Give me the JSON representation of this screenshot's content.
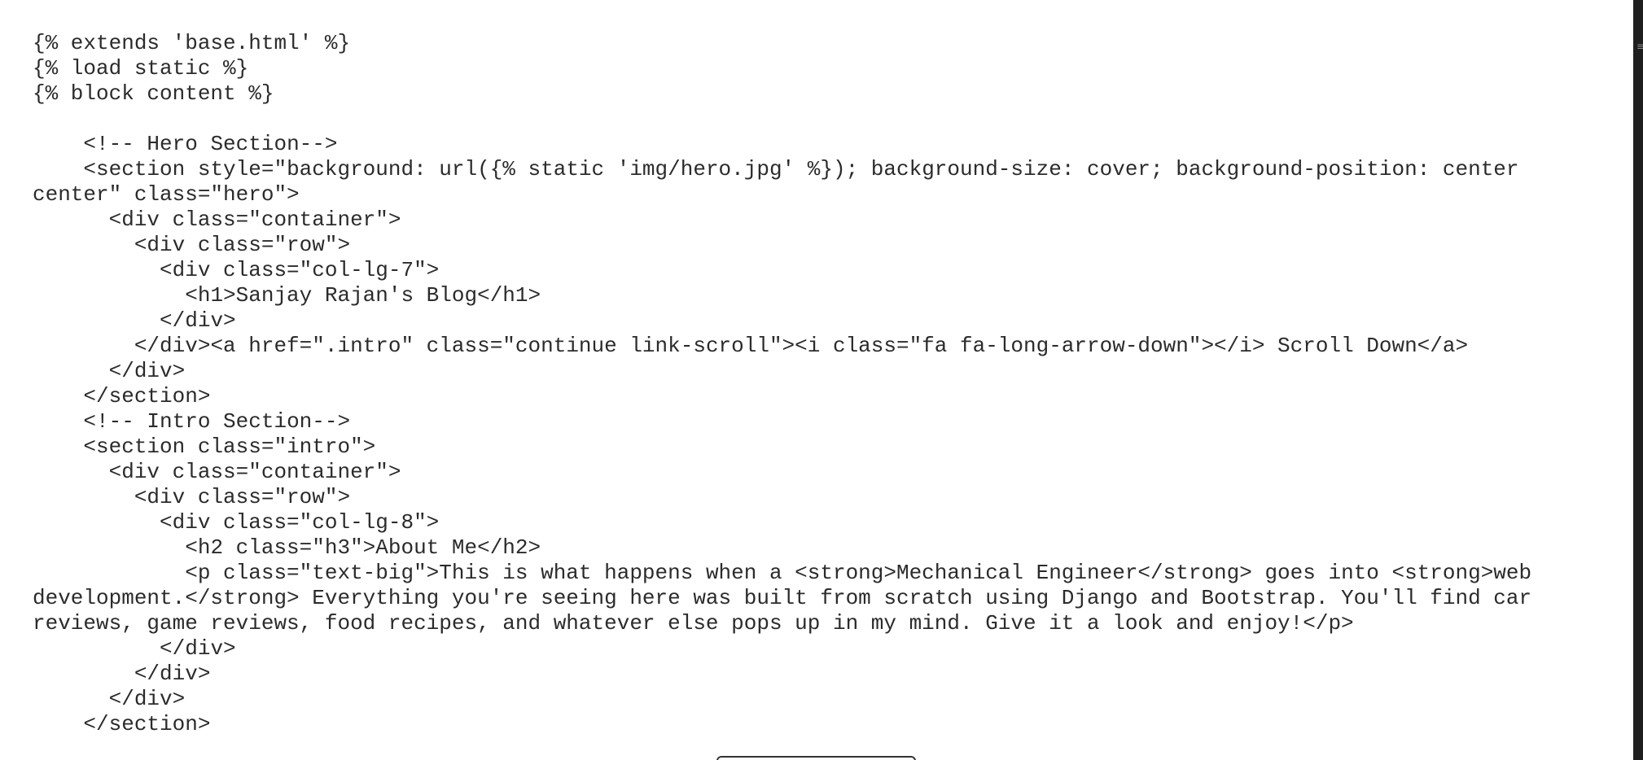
{
  "document": {
    "lines": [
      "{% extends 'base.html' %}",
      "{% load static %}",
      "{% block content %}",
      "",
      "    <!-- Hero Section-->",
      "    <section style=\"background: url({% static 'img/hero.jpg' %}); background-size: cover; background-position: center center\" class=\"hero\">",
      "      <div class=\"container\">",
      "        <div class=\"row\">",
      "          <div class=\"col-lg-7\">",
      "            <h1>Sanjay Rajan's Blog</h1>",
      "          </div>",
      "        </div><a href=\".intro\" class=\"continue link-scroll\"><i class=\"fa fa-long-arrow-down\"></i> Scroll Down</a>",
      "      </div>",
      "    </section>",
      "    <!-- Intro Section-->",
      "    <section class=\"intro\">",
      "      <div class=\"container\">",
      "        <div class=\"row\">",
      "          <div class=\"col-lg-8\">",
      "            <h2 class=\"h3\">About Me</h2>",
      "            <p class=\"text-big\">This is what happens when a <strong>Mechanical Engineer</strong> goes into <strong>web development.</strong> Everything you're seeing here was built from scratch using Django and Bootstrap. You'll find car reviews, game reviews, food recipes, and whatever else pops up in my mind. Give it a look and enjoy!</p>",
      "          </div>",
      "        </div>",
      "      </div>",
      "    </section>"
    ]
  }
}
